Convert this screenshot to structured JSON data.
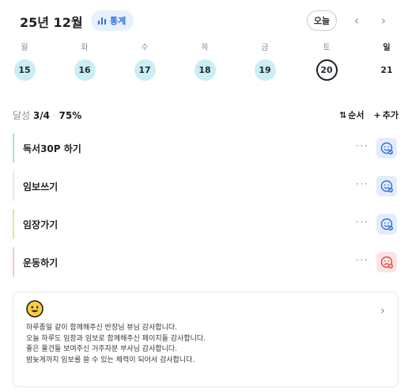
{
  "header": {
    "month_title": "25년 12월",
    "stats_label": "통계",
    "today_label": "오늘",
    "prev_icon": "chevron-left-icon",
    "next_icon": "chevron-right-icon"
  },
  "week": {
    "days": [
      {
        "dow": "월",
        "date": "15"
      },
      {
        "dow": "화",
        "date": "16"
      },
      {
        "dow": "수",
        "date": "17"
      },
      {
        "dow": "목",
        "date": "18"
      },
      {
        "dow": "금",
        "date": "19"
      },
      {
        "dow": "토",
        "date": "20"
      },
      {
        "dow": "일",
        "date": "21"
      }
    ],
    "selected_date": "20"
  },
  "progress": {
    "label": "달성",
    "fraction": "3/4",
    "separator": "·",
    "percent": "75%",
    "sort_label": "순서",
    "add_label": "추가"
  },
  "tasks": [
    {
      "title": "독서30P 하기",
      "bar_color": "#a8e6c9",
      "status": "done"
    },
    {
      "title": "임보쓰기",
      "bar_color": "#e6e8eb",
      "status": "done"
    },
    {
      "title": "임장가기",
      "bar_color": "#dbe99a",
      "status": "done"
    },
    {
      "title": "운동하기",
      "bar_color": "#f7c6d3",
      "status": "failed"
    }
  ],
  "colors": {
    "accent": "#2f6fe0",
    "date_bg": "#c9eef5",
    "status_ok_bg": "#e2ecfb",
    "status_bad_bg": "#fde4e4",
    "status_bad_fg": "#e04848"
  },
  "memo": {
    "emoji": "smiling-face-icon",
    "lines": [
      "하루종일 같이 함께해주신 반장님 뷰님 감사합니다.",
      "오늘 하루도 임장과 임보로 함께해주신 페이지들 감사합니다.",
      "좋은 물건들 보여주신 거주자분 부사님 감사합니다.",
      "밤늦게까지 임보를 쓸 수 있는 체력이 되어서 감사합니다."
    ]
  }
}
